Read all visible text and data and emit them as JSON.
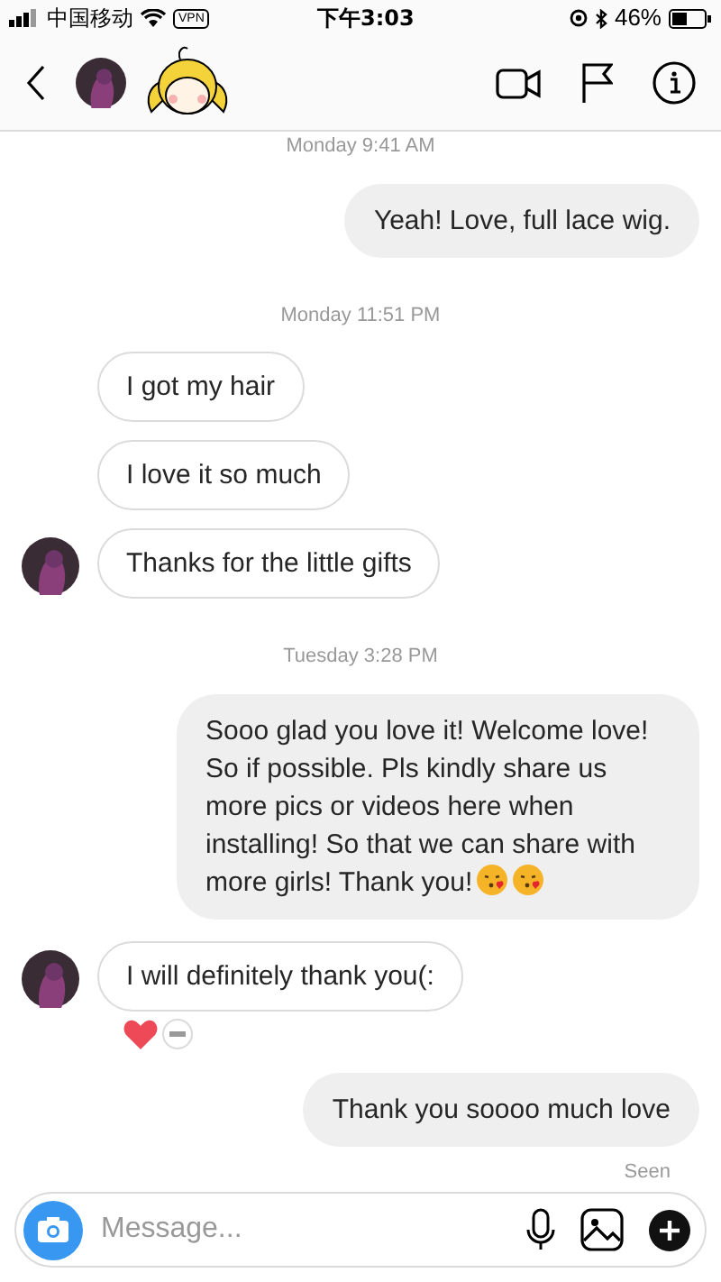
{
  "status_bar": {
    "carrier": "中国移动",
    "vpn": "VPN",
    "time": "下午3:03",
    "battery": "46%"
  },
  "messages": [
    {
      "kind": "timestamp",
      "text": "Monday 9:41 AM"
    },
    {
      "kind": "sent",
      "text": "Yeah! Love, full lace wig."
    },
    {
      "kind": "timestamp",
      "text": "Monday 11:51 PM"
    },
    {
      "kind": "received",
      "text": "I got my hair",
      "show_avatar": false
    },
    {
      "kind": "received",
      "text": "I love it so much",
      "show_avatar": false
    },
    {
      "kind": "received",
      "text": "Thanks for the little gifts",
      "show_avatar": true
    },
    {
      "kind": "timestamp",
      "text": "Tuesday 3:28 PM"
    },
    {
      "kind": "sent",
      "text": "Sooo glad you love it! Welcome love! So if possible. Pls kindly share us more pics or videos here when installing! So that we can share with more girls! Thank you!",
      "trailing_icons": [
        {
          "kind": "kiss"
        },
        {
          "kind": "kiss"
        }
      ]
    },
    {
      "kind": "received",
      "text": "I will definitely thank you(:",
      "show_avatar": true,
      "reactions": [
        {
          "kind": "heart"
        },
        {
          "kind": "avatar"
        }
      ]
    },
    {
      "kind": "sent",
      "text": "Thank you soooo much love"
    },
    {
      "kind": "seen",
      "text": "Seen"
    }
  ],
  "composer": {
    "placeholder": "Message..."
  }
}
